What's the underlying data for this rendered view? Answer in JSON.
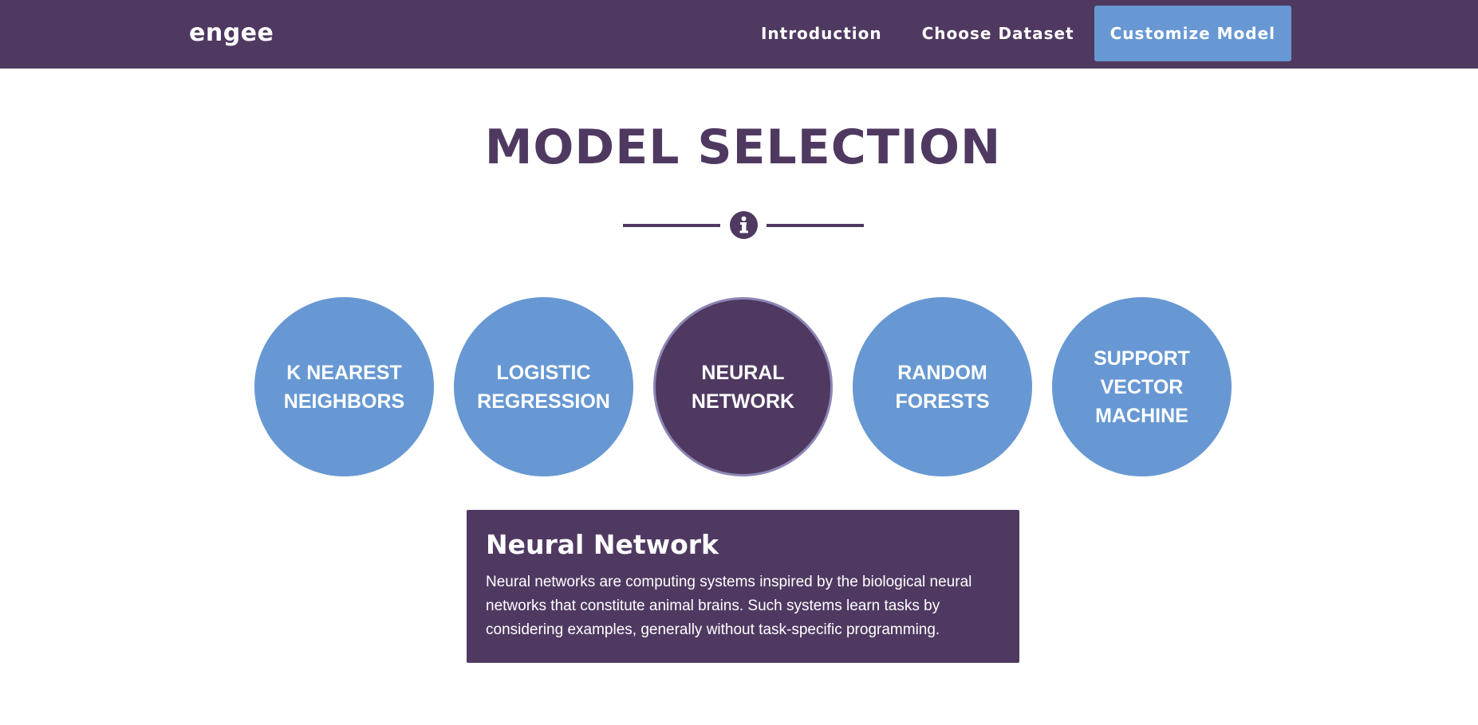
{
  "nav": {
    "brand": "engee",
    "links": [
      {
        "label": "Introduction"
      },
      {
        "label": "Choose Dataset"
      },
      {
        "label": "Customize Model"
      }
    ],
    "active_color": "#6798d3",
    "background_color": "#4f3961"
  },
  "page": {
    "title": "MODEL SELECTION",
    "divider_icon": "info-icon"
  },
  "models": [
    {
      "label": "K NEAREST NEIGHBORS",
      "selected": false
    },
    {
      "label": "LOGISTIC REGRESSION",
      "selected": false
    },
    {
      "label": "NEURAL NETWORK",
      "selected": true
    },
    {
      "label": "RANDOM FORESTS",
      "selected": false
    },
    {
      "label": "SUPPORT VECTOR MACHINE",
      "selected": false
    }
  ],
  "description": {
    "title": "Neural Network",
    "text": "Neural networks are computing systems inspired by the biological neural networks that constitute animal brains. Such systems learn tasks by considering examples, generally without task-specific programming."
  }
}
